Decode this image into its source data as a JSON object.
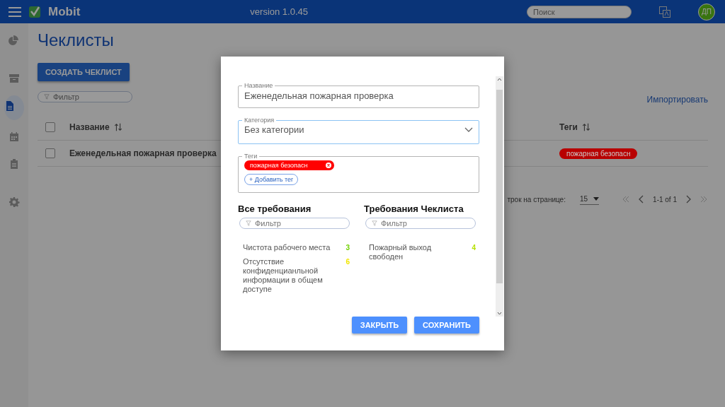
{
  "app_bar": {
    "app_name": "Mobit",
    "version": "version 1.0.45",
    "search": {
      "placeholder": "Поиск"
    },
    "avatar": "ДП"
  },
  "sidebar": {
    "items": [
      {
        "kind": "chart",
        "selected": false
      },
      {
        "kind": "archive",
        "selected": false
      },
      {
        "kind": "document",
        "selected": true
      },
      {
        "kind": "calendar",
        "selected": false
      },
      {
        "kind": "clipboard",
        "selected": false
      },
      {
        "kind": "settings",
        "selected": false
      }
    ]
  },
  "page": {
    "title": "Чеклисты",
    "create_button": "СОЗДАТЬ ЧЕКЛИСТ",
    "filter": {
      "placeholder": "Фильтр"
    },
    "import_link": "Импортировать",
    "table": {
      "header_checked": false,
      "columns": [
        {
          "label": "Название"
        },
        {
          "label": "Теги"
        }
      ],
      "rows": [
        {
          "checked": false,
          "name": "Еженедельная пожарная проверка",
          "tag": {
            "label": "пожарная безопасн",
            "color": "#b80000"
          }
        }
      ]
    },
    "pagination": {
      "rows_label": "трок на странице:",
      "rows_value": "15",
      "range": "1-1 of 1"
    }
  },
  "dialog": {
    "name_field": {
      "label": "Название",
      "value": "Еженедельная пожарная проверка"
    },
    "category_field": {
      "label": "Категория",
      "value": "Без категории"
    },
    "tags_field": {
      "label": "Теги",
      "tags": [
        {
          "label": "пожарная безопасн",
          "color": "#ff0000"
        }
      ],
      "add_button": "+ Добавить тег"
    },
    "columns": [
      {
        "title": "Все требования",
        "filter": {
          "placeholder": "Фильтр"
        },
        "items": [
          {
            "name": "Чистота рабочего места",
            "count": "3",
            "color": "#6fd100"
          },
          {
            "name": "Отсутствие конфиденцианльной информации в общем доступе",
            "count": "6",
            "color": "#f2e600"
          }
        ]
      },
      {
        "title": "Требования Чеклиста",
        "filter": {
          "placeholder": "Фильтр"
        },
        "items": [
          {
            "name": "Пожарный выход свободен",
            "count": "4",
            "color": "#b5e000"
          }
        ]
      }
    ],
    "buttons": [
      "ЗАКРЫТЬ",
      "СОХРАНИТЬ"
    ]
  }
}
